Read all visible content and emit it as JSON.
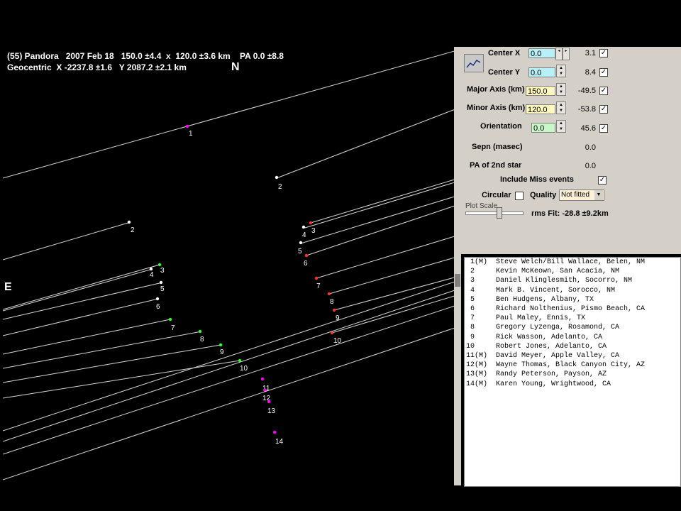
{
  "header": {
    "line1": "(55) Pandora   2007 Feb 18   150.0 ±4.4  x  120.0 ±3.6 km    PA 0.0 ±8.8",
    "line2": "Geocentric  X -2237.8 ±1.6   Y 2087.2 ±2.1 km",
    "north": "N",
    "east": "E"
  },
  "chords": [
    {
      "label": "1",
      "color": "#ff00ff"
    },
    {
      "label": "2",
      "color": "#ffffff"
    },
    {
      "label": "2",
      "color": "#ffffff"
    },
    {
      "label": "4",
      "color": "#ffffff"
    },
    {
      "label": "3",
      "color": "#ff3030"
    },
    {
      "label": "5",
      "color": "#ffffff"
    },
    {
      "label": "6",
      "color": "#ff3030"
    },
    {
      "label": "7",
      "color": "#ff3030"
    },
    {
      "label": "8",
      "color": "#ff3030"
    },
    {
      "label": "9",
      "color": "#ff3030"
    },
    {
      "label": "10",
      "color": "#ff3030"
    },
    {
      "label": "4",
      "color": "#ffffff"
    },
    {
      "label": "3",
      "color": "#30ff30"
    },
    {
      "label": "5",
      "color": "#ffffff"
    },
    {
      "label": "6",
      "color": "#ffffff"
    },
    {
      "label": "7",
      "color": "#30ff30"
    },
    {
      "label": "8",
      "color": "#30ff30"
    },
    {
      "label": "9",
      "color": "#30ff30"
    },
    {
      "label": "10",
      "color": "#30ff30"
    },
    {
      "label": "11",
      "color": "#ff00ff"
    },
    {
      "label": "12",
      "color": "#ff00ff"
    },
    {
      "label": "13",
      "color": "#ff00ff"
    },
    {
      "label": "14",
      "color": "#ff00ff"
    }
  ],
  "panel": {
    "center_x_label": "Center X",
    "center_x_value": "0.0",
    "center_x_result": "3.1",
    "center_y_label": "Center Y",
    "center_y_value": "0.0",
    "center_y_result": "8.4",
    "major_label": "Major Axis (km)",
    "major_value": "150.0",
    "major_result": "-49.5",
    "minor_label": "Minor Axis (km)",
    "minor_value": "120.0",
    "minor_result": "-53.8",
    "orient_label": "Orientation",
    "orient_value": "0.0",
    "orient_result": "45.6",
    "sepn_label": "Sepn (masec)",
    "sepn_value": "0.0",
    "pa2_label": "PA of 2nd star",
    "pa2_value": "0.0",
    "include_miss_label": "Include Miss events",
    "circular_label": "Circular",
    "quality_label": "Quality",
    "quality_value": "Not fitted",
    "plot_scale_label": "Plot Scale",
    "rms_label": "rms Fit: -28.8 ±9.2km",
    "check": "✓",
    "up": "▲",
    "down": "▼",
    "arrow_left": "◂",
    "arrow_right": "▸",
    "dropdown": "▼"
  },
  "observers": [
    " 1(M)  Steve Welch/Bill Wallace, Belen, NM",
    " 2     Kevin McKeown, San Acacia, NM",
    " 3     Daniel Klinglesmith, Socorro, NM",
    " 4     Mark B. Vincent, Sorocco, NM",
    " 5     Ben Hudgens, Albany, TX",
    " 6     Richard Nolthenius, Pismo Beach, CA",
    " 7     Paul Maley, Ennis, TX",
    " 8     Gregory Lyzenga, Rosamond, CA",
    " 9     Rick Wasson, Adelanto, CA",
    "10     Robert Jones, Adelanto, CA",
    "11(M)  David Meyer, Apple Valley, CA",
    "12(M)  Wayne Thomas, Black Canyon City, AZ",
    "13(M)  Randy Peterson, Payson, AZ",
    "14(M)  Karen Young, Wrightwood, CA"
  ]
}
